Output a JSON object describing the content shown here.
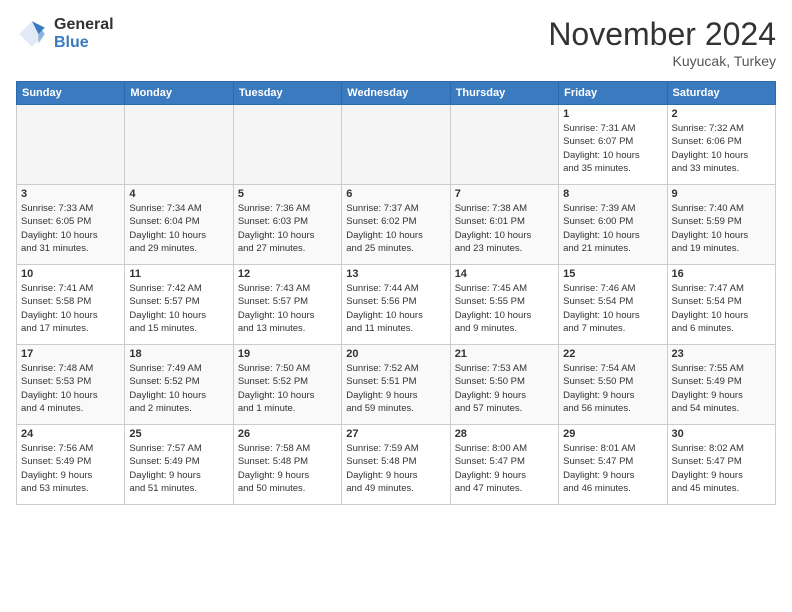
{
  "header": {
    "logo_general": "General",
    "logo_blue": "Blue",
    "month_title": "November 2024",
    "location": "Kuyucak, Turkey"
  },
  "days_of_week": [
    "Sunday",
    "Monday",
    "Tuesday",
    "Wednesday",
    "Thursday",
    "Friday",
    "Saturday"
  ],
  "weeks": [
    [
      {
        "day": "",
        "info": ""
      },
      {
        "day": "",
        "info": ""
      },
      {
        "day": "",
        "info": ""
      },
      {
        "day": "",
        "info": ""
      },
      {
        "day": "",
        "info": ""
      },
      {
        "day": "1",
        "info": "Sunrise: 7:31 AM\nSunset: 6:07 PM\nDaylight: 10 hours\nand 35 minutes."
      },
      {
        "day": "2",
        "info": "Sunrise: 7:32 AM\nSunset: 6:06 PM\nDaylight: 10 hours\nand 33 minutes."
      }
    ],
    [
      {
        "day": "3",
        "info": "Sunrise: 7:33 AM\nSunset: 6:05 PM\nDaylight: 10 hours\nand 31 minutes."
      },
      {
        "day": "4",
        "info": "Sunrise: 7:34 AM\nSunset: 6:04 PM\nDaylight: 10 hours\nand 29 minutes."
      },
      {
        "day": "5",
        "info": "Sunrise: 7:36 AM\nSunset: 6:03 PM\nDaylight: 10 hours\nand 27 minutes."
      },
      {
        "day": "6",
        "info": "Sunrise: 7:37 AM\nSunset: 6:02 PM\nDaylight: 10 hours\nand 25 minutes."
      },
      {
        "day": "7",
        "info": "Sunrise: 7:38 AM\nSunset: 6:01 PM\nDaylight: 10 hours\nand 23 minutes."
      },
      {
        "day": "8",
        "info": "Sunrise: 7:39 AM\nSunset: 6:00 PM\nDaylight: 10 hours\nand 21 minutes."
      },
      {
        "day": "9",
        "info": "Sunrise: 7:40 AM\nSunset: 5:59 PM\nDaylight: 10 hours\nand 19 minutes."
      }
    ],
    [
      {
        "day": "10",
        "info": "Sunrise: 7:41 AM\nSunset: 5:58 PM\nDaylight: 10 hours\nand 17 minutes."
      },
      {
        "day": "11",
        "info": "Sunrise: 7:42 AM\nSunset: 5:57 PM\nDaylight: 10 hours\nand 15 minutes."
      },
      {
        "day": "12",
        "info": "Sunrise: 7:43 AM\nSunset: 5:57 PM\nDaylight: 10 hours\nand 13 minutes."
      },
      {
        "day": "13",
        "info": "Sunrise: 7:44 AM\nSunset: 5:56 PM\nDaylight: 10 hours\nand 11 minutes."
      },
      {
        "day": "14",
        "info": "Sunrise: 7:45 AM\nSunset: 5:55 PM\nDaylight: 10 hours\nand 9 minutes."
      },
      {
        "day": "15",
        "info": "Sunrise: 7:46 AM\nSunset: 5:54 PM\nDaylight: 10 hours\nand 7 minutes."
      },
      {
        "day": "16",
        "info": "Sunrise: 7:47 AM\nSunset: 5:54 PM\nDaylight: 10 hours\nand 6 minutes."
      }
    ],
    [
      {
        "day": "17",
        "info": "Sunrise: 7:48 AM\nSunset: 5:53 PM\nDaylight: 10 hours\nand 4 minutes."
      },
      {
        "day": "18",
        "info": "Sunrise: 7:49 AM\nSunset: 5:52 PM\nDaylight: 10 hours\nand 2 minutes."
      },
      {
        "day": "19",
        "info": "Sunrise: 7:50 AM\nSunset: 5:52 PM\nDaylight: 10 hours\nand 1 minute."
      },
      {
        "day": "20",
        "info": "Sunrise: 7:52 AM\nSunset: 5:51 PM\nDaylight: 9 hours\nand 59 minutes."
      },
      {
        "day": "21",
        "info": "Sunrise: 7:53 AM\nSunset: 5:50 PM\nDaylight: 9 hours\nand 57 minutes."
      },
      {
        "day": "22",
        "info": "Sunrise: 7:54 AM\nSunset: 5:50 PM\nDaylight: 9 hours\nand 56 minutes."
      },
      {
        "day": "23",
        "info": "Sunrise: 7:55 AM\nSunset: 5:49 PM\nDaylight: 9 hours\nand 54 minutes."
      }
    ],
    [
      {
        "day": "24",
        "info": "Sunrise: 7:56 AM\nSunset: 5:49 PM\nDaylight: 9 hours\nand 53 minutes."
      },
      {
        "day": "25",
        "info": "Sunrise: 7:57 AM\nSunset: 5:49 PM\nDaylight: 9 hours\nand 51 minutes."
      },
      {
        "day": "26",
        "info": "Sunrise: 7:58 AM\nSunset: 5:48 PM\nDaylight: 9 hours\nand 50 minutes."
      },
      {
        "day": "27",
        "info": "Sunrise: 7:59 AM\nSunset: 5:48 PM\nDaylight: 9 hours\nand 49 minutes."
      },
      {
        "day": "28",
        "info": "Sunrise: 8:00 AM\nSunset: 5:47 PM\nDaylight: 9 hours\nand 47 minutes."
      },
      {
        "day": "29",
        "info": "Sunrise: 8:01 AM\nSunset: 5:47 PM\nDaylight: 9 hours\nand 46 minutes."
      },
      {
        "day": "30",
        "info": "Sunrise: 8:02 AM\nSunset: 5:47 PM\nDaylight: 9 hours\nand 45 minutes."
      }
    ]
  ]
}
